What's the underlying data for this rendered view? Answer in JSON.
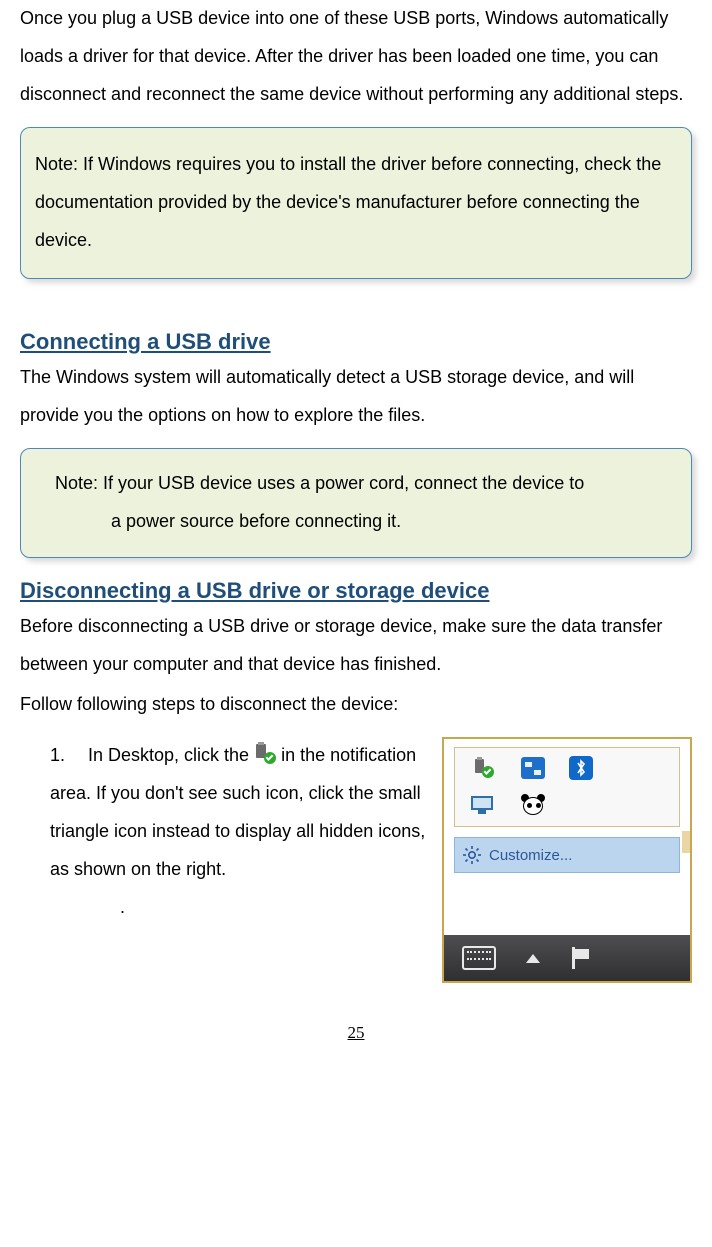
{
  "intro_paragraph": "Once you plug a USB device into one of these USB ports, Windows automatically loads a driver for that device. After the driver has been loaded one time, you can disconnect and reconnect the same device without performing any additional steps.",
  "note1": "Note: If Windows requires you to install the driver before connecting, check the documentation provided by the device's manufacturer before connecting the device.",
  "section1_heading": "Connecting a USB drive",
  "section1_body": "The Windows system will automatically detect a USB storage device, and will provide you the options on how to explore the files.",
  "note2_line1": "Note: If your USB device uses a power cord, connect the device to",
  "note2_line2": "a power source before connecting it.",
  "section2_heading": "Disconnecting a USB drive or storage device",
  "section2_body1": "Before disconnecting a USB drive or storage device, make sure the data transfer between your computer and that device has finished.",
  "section2_body2": "Follow following steps to disconnect the device:",
  "step1_number": "1.",
  "step1_pre": "In Desktop, click the ",
  "step1_post": " in the notification area. If you don't see such icon, click the small triangle icon instead to display all hidden icons, as shown on the right.",
  "step1_dot": ".",
  "tray": {
    "customize_label": "Customize..."
  },
  "page_number": "25"
}
